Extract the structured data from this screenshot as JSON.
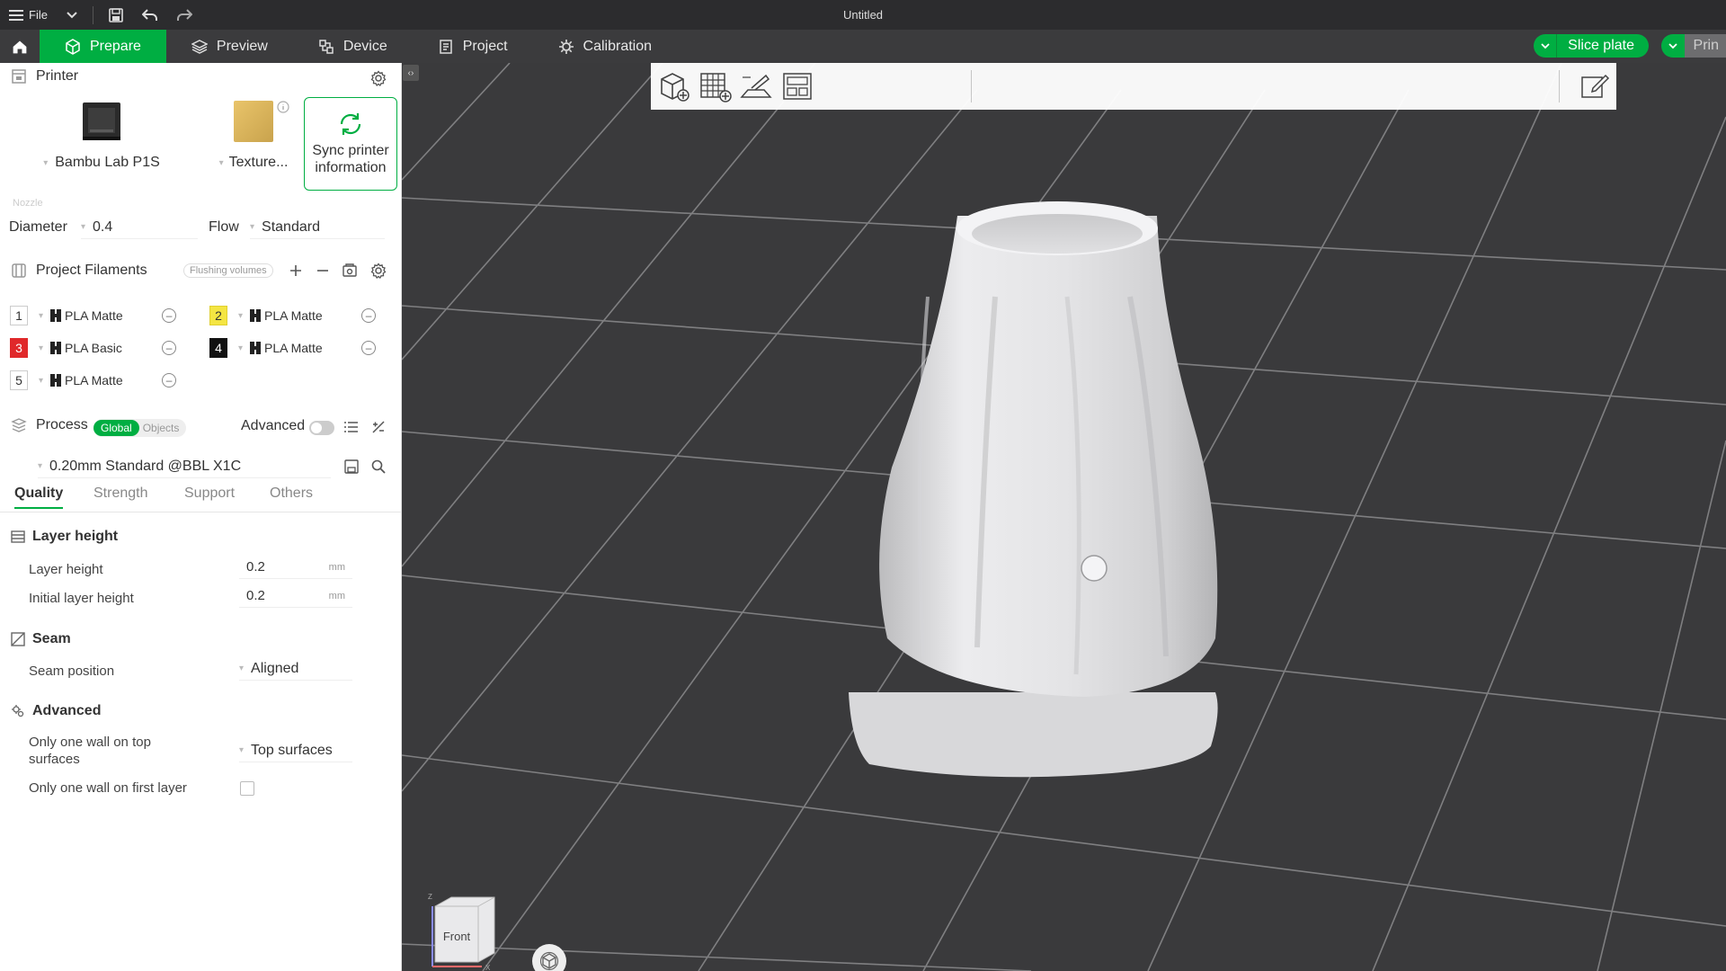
{
  "titlebar": {
    "file_label": "File",
    "title": "Untitled"
  },
  "tabs": [
    {
      "label": "Prepare",
      "icon": "cube-icon",
      "active": true
    },
    {
      "label": "Preview",
      "icon": "layers-icon",
      "active": false
    },
    {
      "label": "Device",
      "icon": "device-icon",
      "active": false
    },
    {
      "label": "Project",
      "icon": "document-icon",
      "active": false
    },
    {
      "label": "Calibration",
      "icon": "calibration-icon",
      "active": false
    }
  ],
  "actions": {
    "slice_label": "Slice plate",
    "print_label": "Prin"
  },
  "printer": {
    "section_title": "Printer",
    "model": "Bambu Lab P1S",
    "plate": "Texture...",
    "sync_label_1": "Sync printer",
    "sync_label_2": "information",
    "faint_label": "Nozzle",
    "diameter_label": "Diameter",
    "diameter_value": "0.4",
    "flow_label": "Flow",
    "flow_value": "Standard"
  },
  "filaments": {
    "section_title": "Project Filaments",
    "flushing_label": "Flushing volumes",
    "items": [
      {
        "index": "1",
        "name": "PLA Matte",
        "badge_bg": "#ffffff",
        "badge_fg": "#333333"
      },
      {
        "index": "2",
        "name": "PLA Matte",
        "badge_bg": "#f4e542",
        "badge_fg": "#333333"
      },
      {
        "index": "3",
        "name": "PLA Basic",
        "badge_bg": "#e0282a",
        "badge_fg": "#ffffff"
      },
      {
        "index": "4",
        "name": "PLA Matte",
        "badge_bg": "#111111",
        "badge_fg": "#ffffff"
      },
      {
        "index": "5",
        "name": "PLA Matte",
        "badge_bg": "#ffffff",
        "badge_fg": "#333333"
      }
    ]
  },
  "process": {
    "section_title": "Process",
    "global_label": "Global",
    "objects_label": "Objects",
    "advanced_label": "Advanced",
    "advanced_on": false,
    "preset": "0.20mm Standard @BBL X1C",
    "tabs": [
      "Quality",
      "Strength",
      "Support",
      "Others"
    ],
    "active_tab": "Quality"
  },
  "quality": {
    "layer_height_group": "Layer height",
    "layer_height_label": "Layer height",
    "layer_height_value": "0.2",
    "initial_layer_label": "Initial layer height",
    "initial_layer_value": "0.2",
    "unit": "mm",
    "seam_group": "Seam",
    "seam_position_label": "Seam position",
    "seam_position_value": "Aligned",
    "advanced_group": "Advanced",
    "one_wall_top_label_1": "Only one wall on top",
    "one_wall_top_label_2": "surfaces",
    "one_wall_top_value": "Top surfaces",
    "one_wall_first_label": "Only one wall on first layer",
    "one_wall_first_checked": false
  },
  "viewport": {
    "cube_face_label": "Front",
    "axis_z": "Z",
    "axis_x": "X"
  },
  "colors": {
    "accent": "#00ae42",
    "titlebar": "#2c2c2e",
    "tabbar": "#3b3b3d",
    "viewport_bg": "#3a3a3c",
    "grid": "#8c8c8e"
  }
}
